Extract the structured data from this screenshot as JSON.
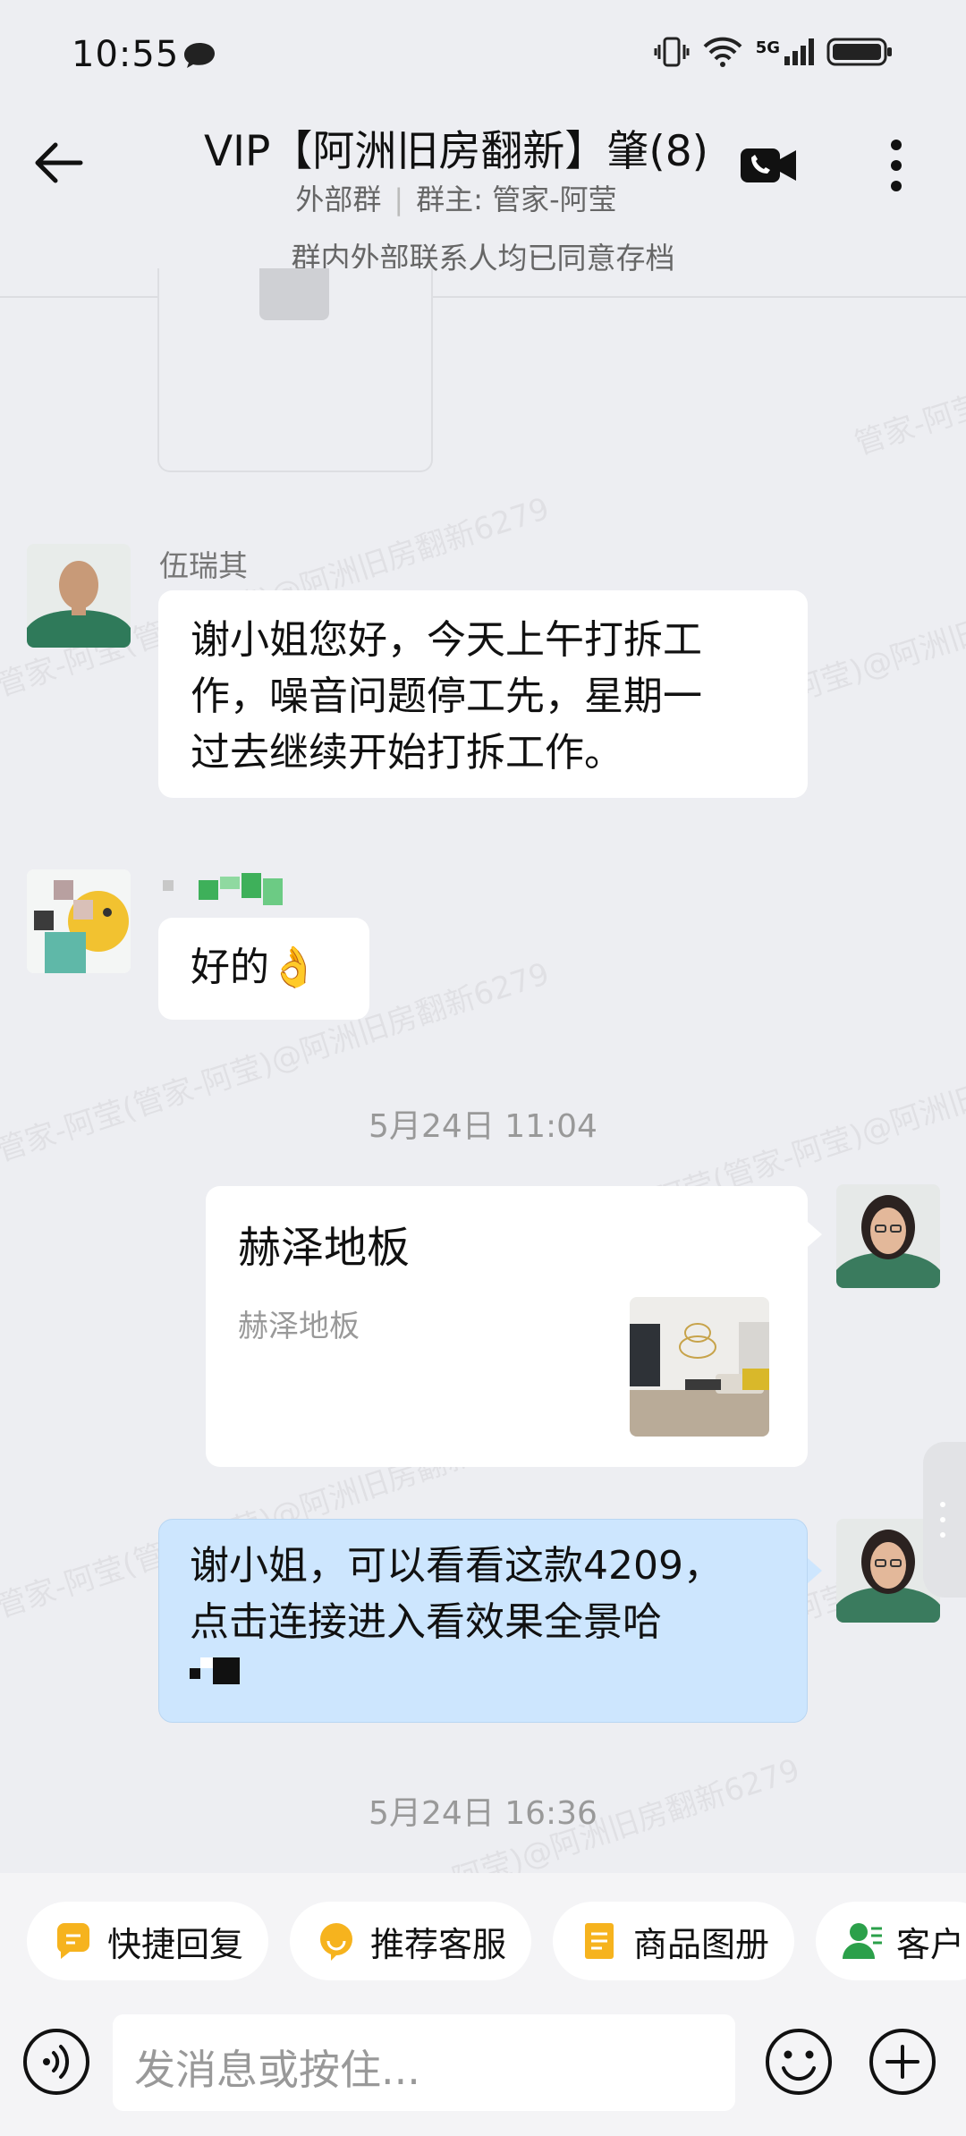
{
  "status_bar": {
    "time": "10:55",
    "network": "5G"
  },
  "header": {
    "title": "VIP【阿洲旧房翻新】肇(8)",
    "subtitle_tag": "外部群",
    "owner": "群主: 管家-阿莹",
    "notice": "群内外部联系人均已同意存档"
  },
  "watermark": "管家-阿莹(管家-阿莹)@阿洲旧房翻新6279",
  "messages": {
    "m1": {
      "sender": "伍瑞其",
      "lines": [
        "谢小姐您好，今天上午打拆工",
        "作，噪音问题停工先，星期一",
        "过去继续开始打拆工作。"
      ]
    },
    "m2": {
      "reply": "好的👌"
    },
    "time1": "5月24日  11:04",
    "card": {
      "title": "赫泽地板",
      "desc": "赫泽地板"
    },
    "m3": {
      "lines": [
        "谢小姐，可以看看这款4209，",
        "点击连接进入看效果全景哈"
      ]
    },
    "time2": "5月24日  16:36"
  },
  "quick_actions": [
    "快捷回复",
    "推荐客服",
    "商品图册",
    "客户"
  ],
  "input": {
    "placeholder": "发消息或按住..."
  },
  "colors": {
    "chip_orange": "#F6B31E",
    "chip_green": "#2BA04A",
    "bubble_blue": "#CDE6FE",
    "background": "#EDEEF2"
  }
}
